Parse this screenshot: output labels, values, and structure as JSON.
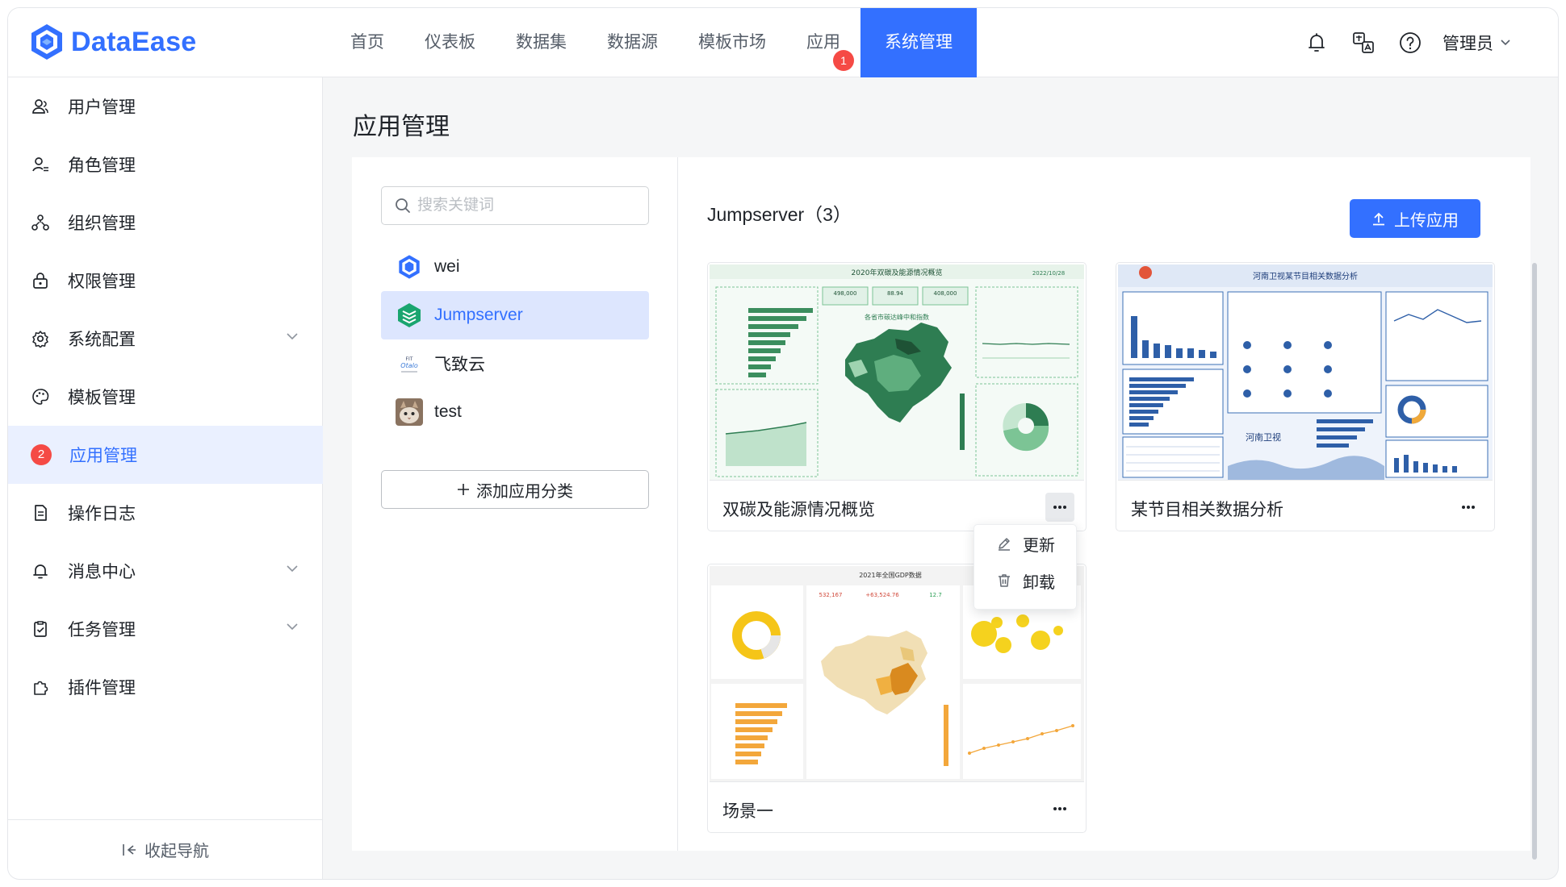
{
  "app": {
    "name": "DataEase"
  },
  "header": {
    "nav": [
      {
        "label": "首页"
      },
      {
        "label": "仪表板"
      },
      {
        "label": "数据集"
      },
      {
        "label": "数据源"
      },
      {
        "label": "模板市场"
      },
      {
        "label": "应用",
        "badge": "1"
      },
      {
        "label": "系统管理",
        "active": true
      }
    ],
    "user": "管理员",
    "icons": [
      "bell-icon",
      "translate-icon",
      "help-icon",
      "chevron-down-icon"
    ]
  },
  "sidebar": {
    "items": [
      {
        "label": "用户管理",
        "icon": "user-icon"
      },
      {
        "label": "角色管理",
        "icon": "role-icon"
      },
      {
        "label": "组织管理",
        "icon": "org-icon"
      },
      {
        "label": "权限管理",
        "icon": "lock-icon"
      },
      {
        "label": "系统配置",
        "icon": "gear-icon",
        "expandable": true
      },
      {
        "label": "模板管理",
        "icon": "palette-icon"
      },
      {
        "label": "应用管理",
        "badge": "2",
        "active": true
      },
      {
        "label": "操作日志",
        "icon": "log-icon"
      },
      {
        "label": "消息中心",
        "icon": "bell-icon",
        "expandable": true
      },
      {
        "label": "任务管理",
        "icon": "task-icon",
        "expandable": true
      },
      {
        "label": "插件管理",
        "icon": "plugin-icon"
      }
    ],
    "collapse_label": "收起导航"
  },
  "main": {
    "title": "应用管理",
    "search": {
      "placeholder": "搜索关键词",
      "value": ""
    },
    "categories": [
      {
        "label": "wei"
      },
      {
        "label": "Jumpserver",
        "active": true
      },
      {
        "label": "飞致云"
      },
      {
        "label": "test"
      }
    ],
    "add_category_label": "添加应用分类",
    "section_title": "Jumpserver（3）",
    "upload_label": "上传应用",
    "cards": [
      {
        "name": "双碳及能源情况概览",
        "thumb_title": "2020年双碳及能源情况概览",
        "thumb_date": "2022/10/28",
        "thumb_map_title": "各省市碳达峰中和指数",
        "thumb_kpis": [
          "498,000",
          "88.94",
          "408,000"
        ]
      },
      {
        "name": "某节目相关数据分析",
        "thumb_title": "河南卫视某节目相关数据分析",
        "thumb_logo": "河南卫视"
      },
      {
        "name": "场景一",
        "thumb_title": "2021年全国GDP数据",
        "thumb_kpis": [
          "532,167",
          "+63,524.76",
          "12.7"
        ]
      }
    ],
    "menu": {
      "items": [
        {
          "label": "更新",
          "icon": "edit-icon"
        },
        {
          "label": "卸载",
          "icon": "trash-icon"
        }
      ]
    }
  },
  "colors": {
    "primary": "#3370ff",
    "badge": "#f54a45",
    "active_bg": "#eaf0ff",
    "map_green": "#2e7d52",
    "map_orange": "#e8a33a",
    "river_blue": "#3b6fb6"
  }
}
